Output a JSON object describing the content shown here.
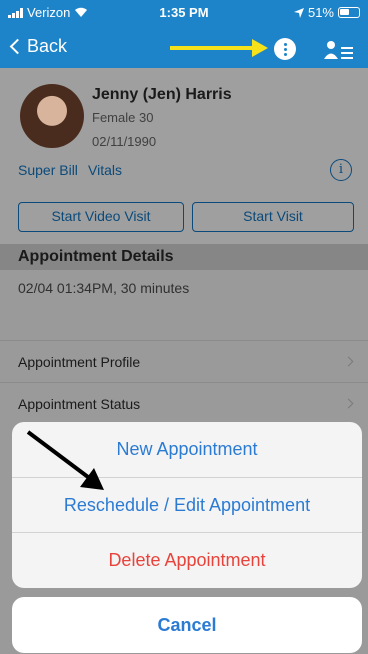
{
  "status_bar": {
    "carrier": "Verizon",
    "time": "1:35 PM",
    "battery": "51%"
  },
  "nav": {
    "back_label": "Back",
    "icons": [
      "more-options-icon",
      "person-list-icon"
    ],
    "annotation_color": "#f6e21a"
  },
  "patient": {
    "name": "Jenny (Jen) Harris",
    "gender_age": "Female 30",
    "dob": "02/11/1990"
  },
  "links": {
    "super_bill": "Super Bill",
    "vitals": "Vitals"
  },
  "visit_buttons": {
    "video": "Start Video Visit",
    "visit": "Start Visit"
  },
  "appointment": {
    "header": "Appointment Details",
    "time": "02/04 01:34PM, 30 minutes",
    "rows": [
      "Appointment Profile",
      "Appointment Status"
    ]
  },
  "action_sheet": {
    "new": "New Appointment",
    "reschedule": "Reschedule / Edit Appointment",
    "delete": "Delete Appointment",
    "cancel": "Cancel"
  },
  "colors": {
    "nav_blue": "#1e84c9",
    "action_blue": "#2b7bd3",
    "destructive_red": "#e8433a"
  }
}
